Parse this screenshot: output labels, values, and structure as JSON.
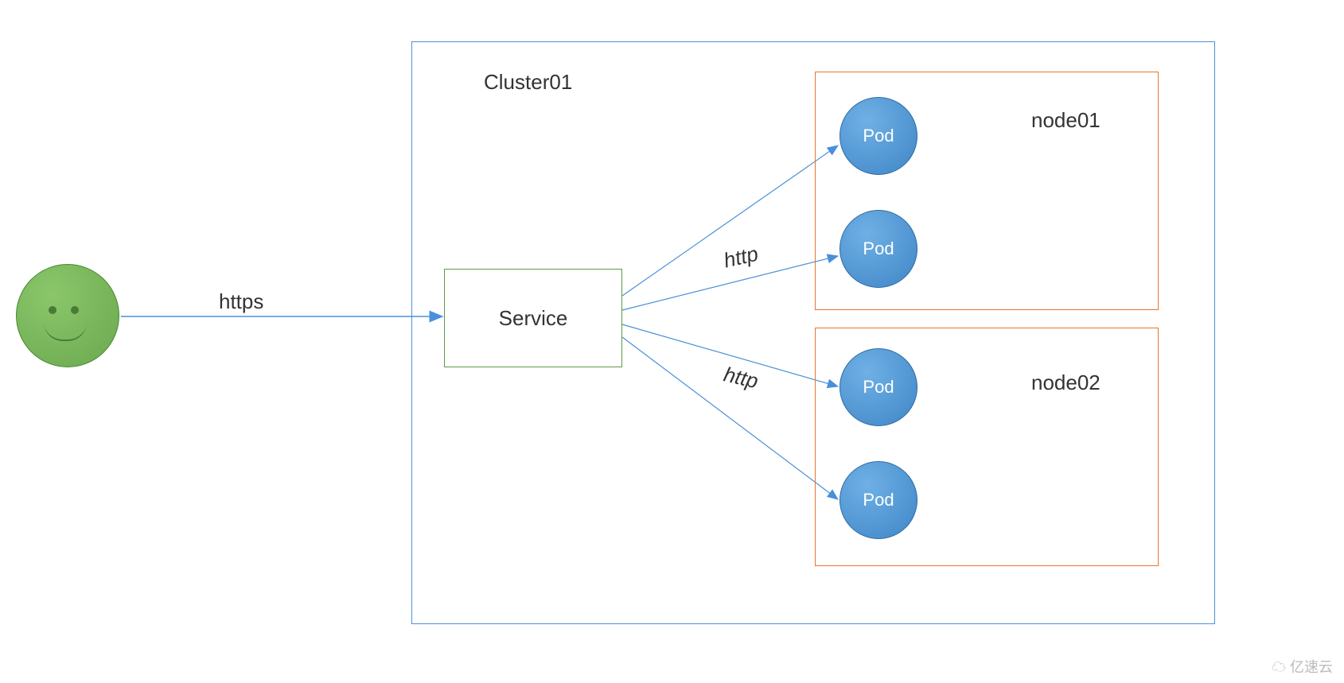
{
  "diagram": {
    "cluster": {
      "label": "Cluster01"
    },
    "user_face": {
      "name": "user"
    },
    "service": {
      "label": "Service"
    },
    "nodes": [
      {
        "id": "node01",
        "label": "node01",
        "pods": [
          {
            "label": "Pod"
          },
          {
            "label": "Pod"
          }
        ]
      },
      {
        "id": "node02",
        "label": "node02",
        "pods": [
          {
            "label": "Pod"
          },
          {
            "label": "Pod"
          }
        ]
      }
    ],
    "edges": {
      "user_to_service": {
        "label": "https"
      },
      "service_to_node01": {
        "label": "http"
      },
      "service_to_node02": {
        "label": "http"
      }
    },
    "colors": {
      "cluster_border": "#4a90d9",
      "node_border": "#e8762c",
      "service_border": "#5b9b42",
      "pod_fill": "#4a90d9",
      "user_fill": "#6aa84f",
      "arrow": "#4a90d9"
    },
    "watermark": "亿速云"
  }
}
